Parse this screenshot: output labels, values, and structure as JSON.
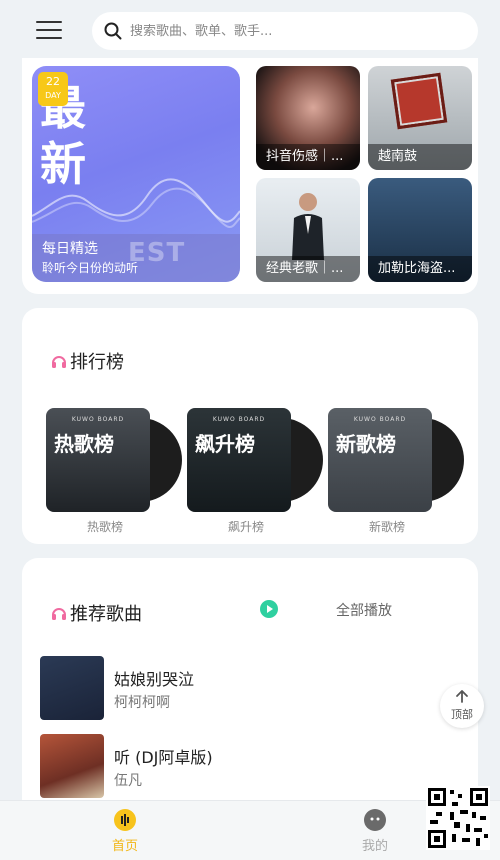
{
  "header": {
    "search_placeholder": "搜索歌曲、歌单、歌手..."
  },
  "featured": {
    "daily_big_text": "最新",
    "daily_badge_day": "22",
    "daily_badge_unit": "DAY",
    "daily_ghost_text": "EST",
    "daily_title": "每日精选",
    "daily_subtitle": "聆听今日份的动听",
    "tiles": [
      {
        "label": "抖音伤感｜..."
      },
      {
        "label": "越南鼓"
      },
      {
        "label": "经典老歌｜..."
      },
      {
        "label": "加勒比海盗..."
      }
    ]
  },
  "ranking": {
    "title": "排行榜",
    "items": [
      {
        "cover_text": "热歌榜",
        "label": "热歌榜",
        "brand": "KUWO BOARD"
      },
      {
        "cover_text": "飙升榜",
        "label": "飙升榜",
        "brand": "KUWO BOARD"
      },
      {
        "cover_text": "新歌榜",
        "label": "新歌榜",
        "brand": "KUWO BOARD"
      }
    ]
  },
  "recommend": {
    "title": "推荐歌曲",
    "play_all": "全部播放",
    "songs": [
      {
        "title": "姑娘别哭泣",
        "artist": "柯柯柯啊"
      },
      {
        "title": "听 (DJ阿卓版)",
        "artist": "伍凡"
      }
    ]
  },
  "floating": {
    "top_label": "顶部"
  },
  "tabbar": {
    "home": "首页",
    "mine": "我的"
  },
  "colors": {
    "accent": "#f7c31c",
    "play_green": "#2fd0a0",
    "page_bg": "#eef2f5"
  }
}
